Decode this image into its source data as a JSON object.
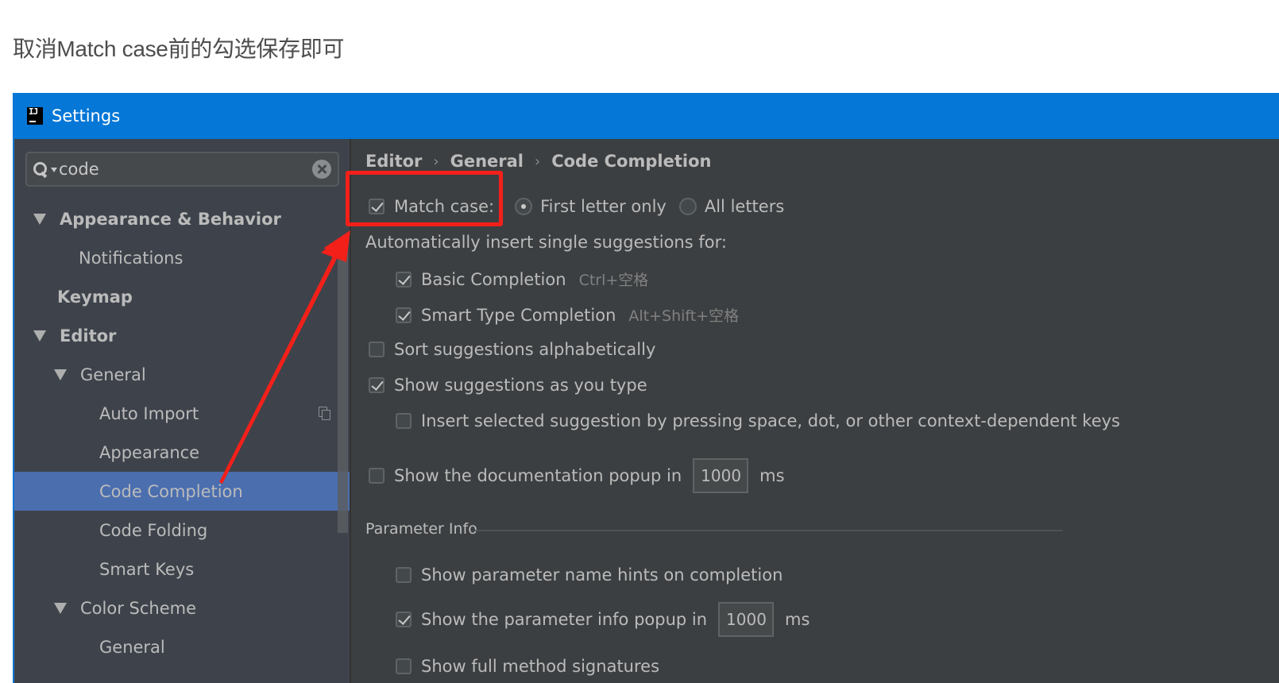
{
  "caption": "取消Match case前的勾选保存即可",
  "window": {
    "title": "Settings",
    "app_icon": "intellij-idea-icon",
    "titlebar_color": "#0477d7"
  },
  "sidebar": {
    "search": {
      "value": "code",
      "placeholder": ""
    },
    "items": [
      {
        "label": "Appearance & Behavior",
        "level": 0,
        "expandable": true,
        "bold": true
      },
      {
        "label": "Notifications",
        "level": 1,
        "expandable": false,
        "bold": false
      },
      {
        "label": "Keymap",
        "level": 0,
        "expandable": false,
        "bold": true
      },
      {
        "label": "Editor",
        "level": 0,
        "expandable": true,
        "bold": true
      },
      {
        "label": "General",
        "level": 1,
        "expandable": true,
        "bold": false
      },
      {
        "label": "Auto Import",
        "level": 2,
        "expandable": false,
        "bold": false,
        "badge_icon": "copy-icon"
      },
      {
        "label": "Appearance",
        "level": 2,
        "expandable": false,
        "bold": false
      },
      {
        "label": "Code Completion",
        "level": 2,
        "expandable": false,
        "bold": false,
        "selected": true
      },
      {
        "label": "Code Folding",
        "level": 2,
        "expandable": false,
        "bold": false
      },
      {
        "label": "Smart Keys",
        "level": 2,
        "expandable": false,
        "bold": false
      },
      {
        "label": "Color Scheme",
        "level": 1,
        "expandable": true,
        "bold": false
      },
      {
        "label": "General",
        "level": 2,
        "expandable": false,
        "bold": false
      }
    ],
    "selected_color": "#4b6eaf"
  },
  "content": {
    "breadcrumb": [
      "Editor",
      "General",
      "Code Completion"
    ],
    "match_case": {
      "label": "Match case:",
      "checked": true
    },
    "match_case_options": [
      {
        "label": "First letter only",
        "selected": true
      },
      {
        "label": "All letters",
        "selected": false
      }
    ],
    "auto_insert_label": "Automatically insert single suggestions for:",
    "basic_completion": {
      "label": "Basic Completion",
      "shortcut": "Ctrl+空格",
      "checked": true
    },
    "smart_type_completion": {
      "label": "Smart Type Completion",
      "shortcut": "Alt+Shift+空格",
      "checked": true
    },
    "sort_alphabetically": {
      "label": "Sort suggestions alphabetically",
      "checked": false
    },
    "show_as_you_type": {
      "label": "Show suggestions as you type",
      "checked": true
    },
    "insert_by_space": {
      "label": "Insert selected suggestion by pressing space, dot, or other context-dependent keys",
      "checked": false
    },
    "doc_popup": {
      "label": "Show the documentation popup in",
      "value": "1000",
      "unit": "ms",
      "checked": false
    },
    "parameter_info": {
      "section_title": "Parameter Info",
      "name_hints": {
        "label": "Show parameter name hints on completion",
        "checked": false
      },
      "info_popup": {
        "label": "Show the parameter info popup in",
        "value": "1000",
        "unit": "ms",
        "checked": true
      },
      "full_signatures": {
        "label": "Show full method signatures",
        "checked": false
      }
    }
  },
  "annotation": {
    "highlight": "match-case-checkbox",
    "color": "#f3201a"
  }
}
